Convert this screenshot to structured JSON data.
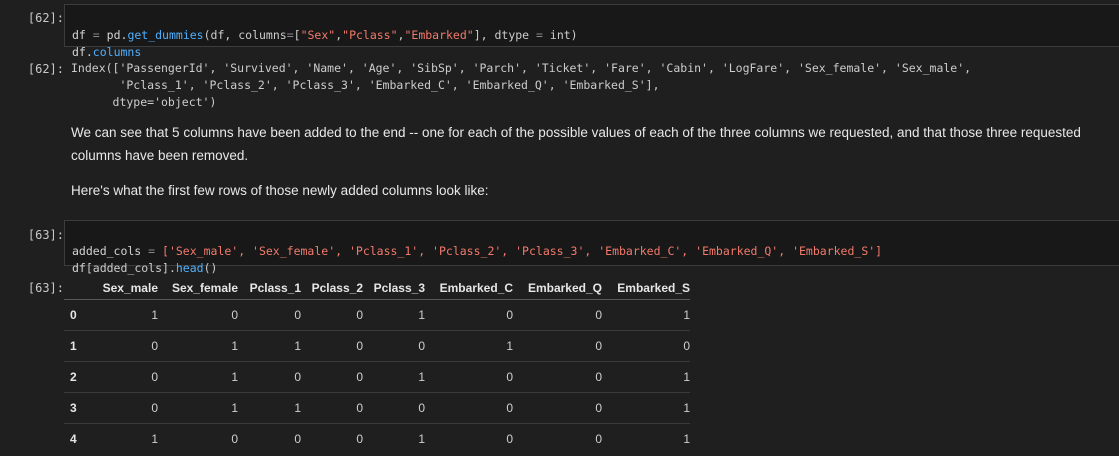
{
  "cells": [
    {
      "prompt_in": "[62]:",
      "prompt_out": "[62]:"
    },
    {
      "prompt_in": "[63]:",
      "prompt_out": "[63]:"
    }
  ],
  "code62": {
    "l1": [
      "df",
      " = ",
      "pd",
      ".",
      "get_dummies",
      "(df, columns",
      "=",
      "[",
      "\"Sex\"",
      ",",
      "\"Pclass\"",
      ",",
      "\"Embarked\"",
      "], dtype ",
      "=",
      " int)"
    ],
    "l2": [
      "df",
      ".",
      "columns"
    ]
  },
  "output62": [
    "Index(['PassengerId', 'Survived', 'Name', 'Age', 'SibSp', 'Parch', 'Ticket', 'Fare', 'Cabin', 'LogFare', 'Sex_female', 'Sex_male',",
    "       'Pclass_1', 'Pclass_2', 'Pclass_3', 'Embarked_C', 'Embarked_Q', 'Embarked_S'],",
    "      dtype='object')"
  ],
  "markdown": {
    "p1": "We can see that 5 columns have been added to the end -- one for each of the possible values of each of the three columns we requested, and that those three requested columns have been removed.",
    "p2": "Here's what the first few rows of those newly added columns look like:"
  },
  "code63": {
    "l1_var": "added_cols",
    "l1_eq": " = ",
    "l1_list": "['Sex_male', 'Sex_female', 'Pclass_1', 'Pclass_2', 'Pclass_3', 'Embarked_C', 'Embarked_Q', 'Embarked_S']",
    "l2_a": "df",
    "l2_b": "[added_cols].",
    "l2_c": "head",
    "l2_d": "()"
  },
  "table": {
    "columns": [
      "Sex_male",
      "Sex_female",
      "Pclass_1",
      "Pclass_2",
      "Pclass_3",
      "Embarked_C",
      "Embarked_Q",
      "Embarked_S"
    ],
    "rows": [
      {
        "index": "0",
        "values": [
          "1",
          "0",
          "0",
          "0",
          "1",
          "0",
          "0",
          "1"
        ]
      },
      {
        "index": "1",
        "values": [
          "0",
          "1",
          "1",
          "0",
          "0",
          "1",
          "0",
          "0"
        ]
      },
      {
        "index": "2",
        "values": [
          "0",
          "1",
          "0",
          "0",
          "1",
          "0",
          "0",
          "1"
        ]
      },
      {
        "index": "3",
        "values": [
          "0",
          "1",
          "1",
          "0",
          "0",
          "0",
          "0",
          "1"
        ]
      },
      {
        "index": "4",
        "values": [
          "1",
          "0",
          "0",
          "0",
          "1",
          "0",
          "0",
          "1"
        ]
      }
    ]
  }
}
